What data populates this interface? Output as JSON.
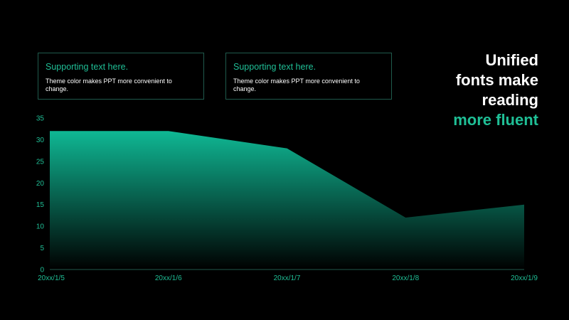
{
  "cards": [
    {
      "title": "Supporting text here.",
      "text": "Theme color makes PPT more convenient to change."
    },
    {
      "title": "Supporting text here.",
      "text": "Theme color makes PPT more convenient to change."
    }
  ],
  "headline": {
    "line1": "Unified",
    "line2": "fonts make",
    "line3": "reading",
    "line4": "more fluent"
  },
  "colors": {
    "accent": "#1fbf96",
    "background": "#000000",
    "area_top": "#0fb894",
    "area_bottom": "#000000"
  },
  "chart_data": {
    "type": "area",
    "categories": [
      "20xx/1/5",
      "20xx/1/6",
      "20xx/1/7",
      "20xx/1/8",
      "20xx/1/9"
    ],
    "values": [
      32,
      32,
      28,
      12,
      15
    ],
    "ylim": [
      0,
      35
    ],
    "yticks": [
      0,
      5,
      10,
      15,
      20,
      25,
      30,
      35
    ],
    "grid": false,
    "legend": "none"
  }
}
